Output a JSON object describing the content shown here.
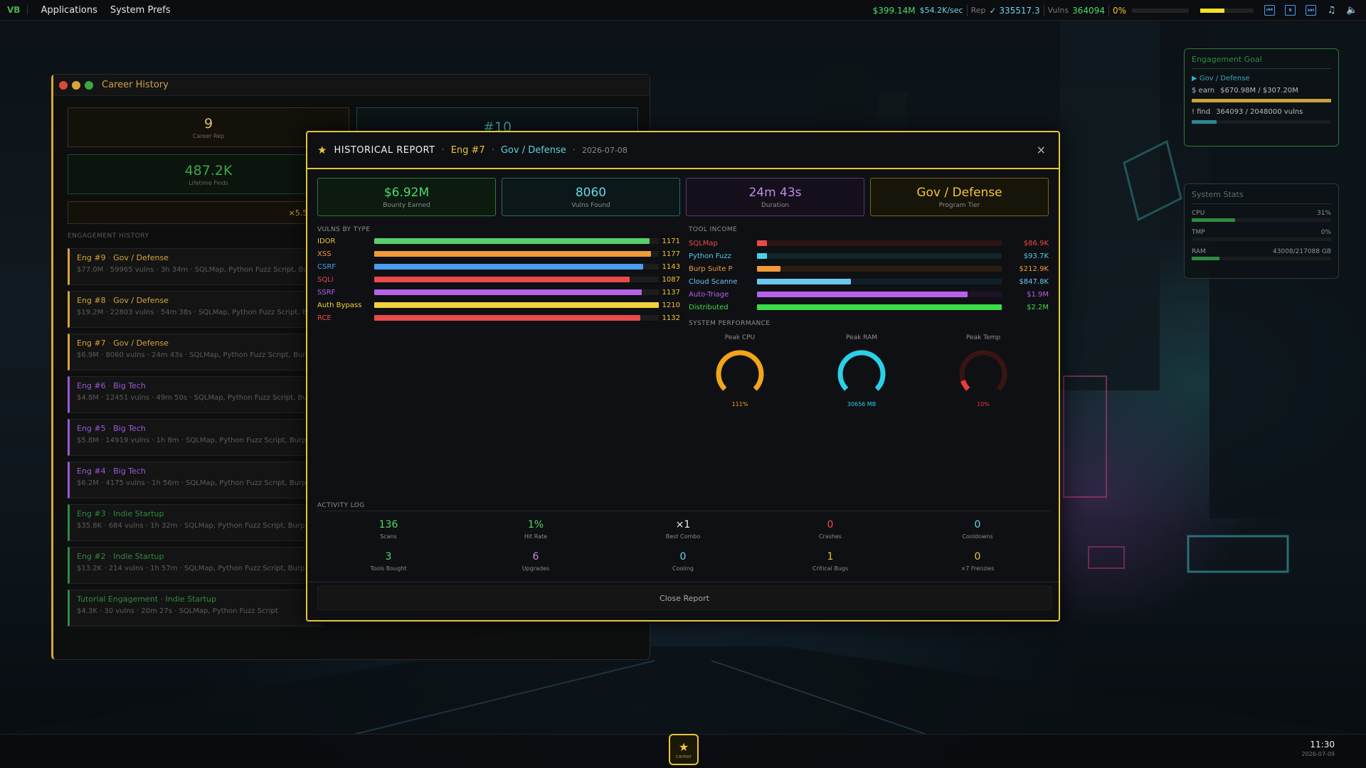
{
  "topbar": {
    "logo": "VB",
    "menus": [
      "Applications",
      "System Prefs"
    ],
    "money": "$399.14M",
    "rate": "$54.2K/sec",
    "rep_label": "Rep",
    "rep_value": "✓ 335517.3",
    "vulns_label": "Vulns",
    "vulns_value": "364094",
    "percent": "0%",
    "yellow_bar_fraction": 0.45,
    "icons": [
      "prev-track-icon",
      "pause-icon",
      "next-track-icon",
      "music-note-icon",
      "volume-icon"
    ]
  },
  "career": {
    "title": "Career History",
    "stats": [
      {
        "value": "9",
        "label": "Career Rep"
      },
      {
        "value": "#10",
        "label": ""
      },
      {
        "value": "487.2K",
        "label": "Lifetime Finds"
      },
      {
        "value": "×5.5 income",
        "label": ""
      }
    ],
    "section": "ENGAGEMENT HISTORY",
    "engagements": [
      {
        "title": "Eng #9",
        "tier": "Gov / Defense",
        "details": "$77.0M · 59965 vulns · 3h 34m · SQLMap, Python Fuzz Script, Burp",
        "color": "#d8a53a"
      },
      {
        "title": "Eng #8",
        "tier": "Gov / Defense",
        "details": "$19.2M · 22803 vulns · 54m 38s · SQLMap, Python Fuzz Script, Bu",
        "color": "#d8a53a"
      },
      {
        "title": "Eng #7",
        "tier": "Gov / Defense",
        "details": "$6.9M · 8060 vulns · 24m 43s · SQLMap, Python Fuzz Script, Burp",
        "color": "#d8a53a"
      },
      {
        "title": "Eng #6",
        "tier": "Big Tech",
        "details": "$4.8M · 12451 vulns · 49m 50s · SQLMap, Python Fuzz Script, Bur",
        "color": "#9b59d8"
      },
      {
        "title": "Eng #5",
        "tier": "Big Tech",
        "details": "$5.8M · 14919 vulns · 1h 8m · SQLMap, Python Fuzz Script, Burp",
        "color": "#9b59d8"
      },
      {
        "title": "Eng #4",
        "tier": "Big Tech",
        "details": "$6.2M · 4175 vulns · 1h 56m · SQLMap, Python Fuzz Script, Burp",
        "color": "#9b59d8"
      },
      {
        "title": "Eng #3",
        "tier": "Indie Startup",
        "details": "$35.8K · 684 vulns · 1h 32m · SQLMap, Python Fuzz Script, Burp S",
        "color": "#2f8a3f"
      },
      {
        "title": "Eng #2",
        "tier": "Indie Startup",
        "details": "$13.2K · 214 vulns · 1h 57m · SQLMap, Python Fuzz Script, Burp S",
        "color": "#2f8a3f"
      },
      {
        "title": "Tutorial Engagement",
        "tier": "Indie Startup",
        "details": "$4.3K · 30 vulns · 20m 27s · SQLMap, Python Fuzz Script",
        "color": "#2f8a3f"
      }
    ]
  },
  "modal": {
    "title": "HISTORICAL REPORT",
    "eng": "Eng #7",
    "tier": "Gov / Defense",
    "date": "2026-07-08",
    "close_icon": "×",
    "cards": [
      {
        "value": "$6.92M",
        "label": "Bounty Earned",
        "color": "#4cdc6c",
        "border": "#2f7a3a",
        "bg": "#0c1a0f"
      },
      {
        "value": "8060",
        "label": "Vulns Found",
        "color": "#6ad6e6",
        "border": "#2a6a72",
        "bg": "#0b1718"
      },
      {
        "value": "24m 43s",
        "label": "Duration",
        "color": "#c08ae8",
        "border": "#5a3a7a",
        "bg": "#140f1a"
      },
      {
        "value": "Gov / Defense",
        "label": "Program Tier",
        "color": "#f2c531",
        "border": "#7a6420",
        "bg": "#17140a"
      }
    ],
    "vulns_heading": "VULNS BY TYPE",
    "vulns": [
      {
        "name": "IDOR",
        "count": "1171",
        "value": 1171,
        "color": "#58d068",
        "name_color": "#f2c531"
      },
      {
        "name": "XSS",
        "count": "1177",
        "value": 1177,
        "color": "#f29a3a",
        "name_color": "#f29a3a"
      },
      {
        "name": "CSRF",
        "count": "1143",
        "value": 1143,
        "color": "#4a9df0",
        "name_color": "#4a9df0"
      },
      {
        "name": "SQLi",
        "count": "1087",
        "value": 1087,
        "color": "#ea4a4a",
        "name_color": "#ea4a4a"
      },
      {
        "name": "SSRF",
        "count": "1137",
        "value": 1137,
        "color": "#b860e8",
        "name_color": "#b860e8"
      },
      {
        "name": "Auth Bypass",
        "count": "1210",
        "value": 1210,
        "color": "#f2d23a",
        "name_color": "#f2d23a"
      },
      {
        "name": "RCE",
        "count": "1132",
        "value": 1132,
        "color": "#ea4a4a",
        "name_color": "#ea4a4a"
      }
    ],
    "tools_heading": "TOOL INCOME",
    "tools": [
      {
        "name": "SQLMap",
        "income": "$86.9K",
        "fraction": 0.039,
        "color": "#ea4a4a",
        "track": "#2a1414"
      },
      {
        "name": "Python Fuzz",
        "income": "$93.7K",
        "fraction": 0.042,
        "color": "#4ad0e8",
        "track": "#10262a"
      },
      {
        "name": "Burp Suite P",
        "income": "$212.9K",
        "fraction": 0.097,
        "color": "#f29a3a",
        "track": "#2a1d10"
      },
      {
        "name": "Cloud Scanne",
        "income": "$847.8K",
        "fraction": 0.385,
        "color": "#6ac8f0",
        "track": "#10202a"
      },
      {
        "name": "Auto-Triage",
        "income": "$1.9M",
        "fraction": 0.86,
        "color": "#b860e8",
        "track": "#1f1228"
      },
      {
        "name": "Distributed",
        "income": "$2.2M",
        "fraction": 1.0,
        "color": "#3adc4a",
        "track": "#102a14"
      }
    ],
    "perf_heading": "SYSTEM PERFORMANCE",
    "gauges": [
      {
        "label": "Peak CPU",
        "value": "111%",
        "fraction": 1.0,
        "color": "#f2a51a"
      },
      {
        "label": "Peak RAM",
        "value": "30656 MB",
        "fraction": 1.0,
        "color": "#2ad0e8"
      },
      {
        "label": "Peak Temp",
        "value": "10%",
        "fraction": 0.1,
        "color": "#ea3a3a"
      }
    ],
    "log_heading": "ACTIVITY LOG",
    "activity": [
      {
        "value": "136",
        "label": "Scans",
        "color": "#4cdc6c"
      },
      {
        "value": "1%",
        "label": "Hit Rate",
        "color": "#4cdc6c"
      },
      {
        "value": "×1",
        "label": "Best Combo",
        "color": "#f0f0f0"
      },
      {
        "value": "0",
        "label": "Crashes",
        "color": "#ea4a4a"
      },
      {
        "value": "0",
        "label": "Cooldowns",
        "color": "#6ad6e6"
      },
      {
        "value": "3",
        "label": "Tools Bought",
        "color": "#4cdc6c"
      },
      {
        "value": "6",
        "label": "Upgrades",
        "color": "#c08ae8"
      },
      {
        "value": "0",
        "label": "Cooling",
        "color": "#6ad6e6"
      },
      {
        "value": "1",
        "label": "Critical Bugs",
        "color": "#f2c531"
      },
      {
        "value": "0",
        "label": "×7 Frenzies",
        "color": "#f2c531"
      }
    ],
    "close_button": "Close Report"
  },
  "goal": {
    "heading": "Engagement Goal",
    "tier": "▶ Gov / Defense",
    "earn_label": "$ earn",
    "earn_value": "$670.98M / $307.20M",
    "earn_fraction": 1.0,
    "find_label": "! find",
    "find_value": "364093 / 2048000 vulns",
    "find_fraction": 0.18
  },
  "sys": {
    "heading": "System Stats",
    "cpu_label": "CPU",
    "cpu_value": "31%",
    "cpu_fraction": 0.31,
    "tmp_label": "TMP",
    "tmp_value": "0%",
    "tmp_fraction": 0.0,
    "ram_label": "RAM",
    "ram_value": "43008/217088 GB",
    "ram_fraction": 0.2
  },
  "taskbar": {
    "app_icon": "★",
    "app_label": "career",
    "time": "11:30",
    "date": "2026-07-09"
  }
}
